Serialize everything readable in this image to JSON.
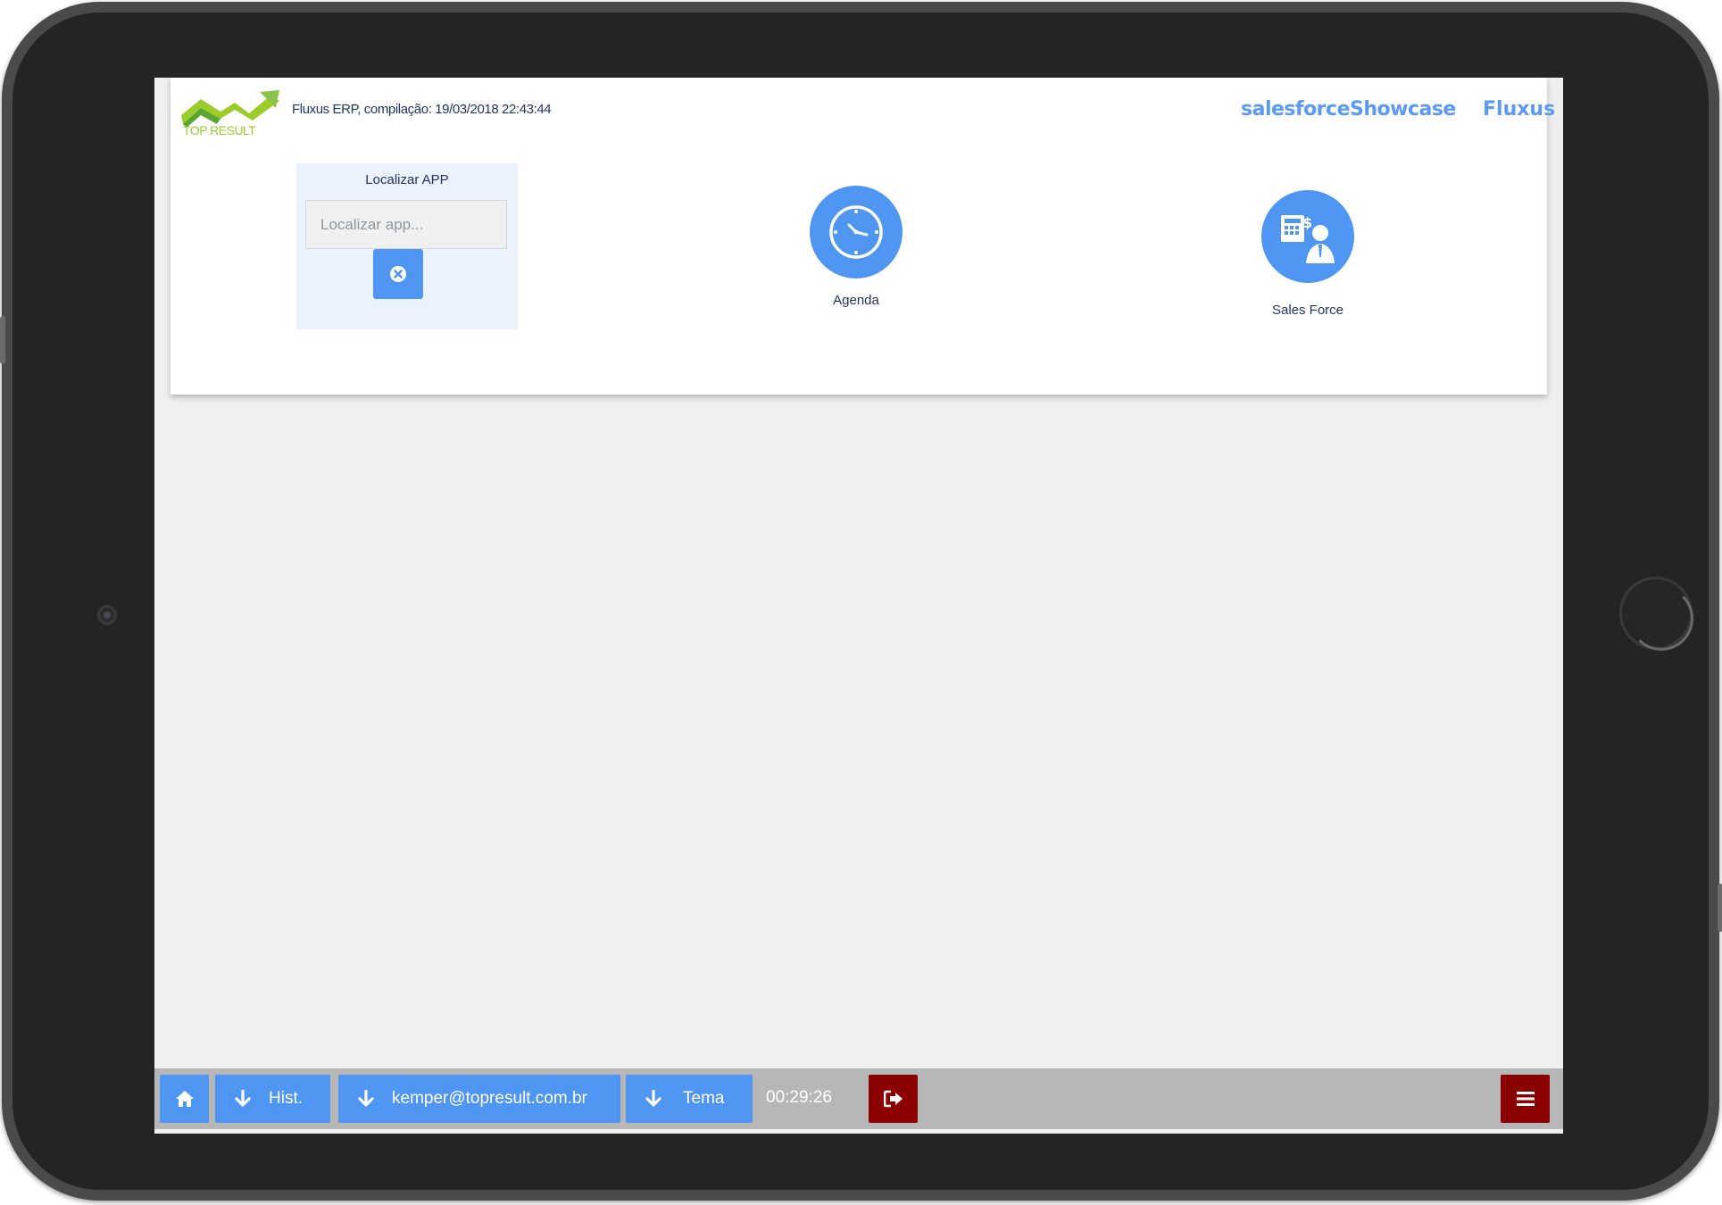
{
  "header": {
    "logo_text": "TOP RESULT",
    "build_info": "Fluxus ERP, compilação: 19/03/2018 22:43:44",
    "org_name": "salesforceShowcase",
    "app_name": "Fluxus"
  },
  "search": {
    "title": "Localizar APP",
    "placeholder": "Localizar app...",
    "clear_icon": "times-circle-icon"
  },
  "apps": [
    {
      "label": "Agenda",
      "icon": "clock-icon"
    },
    {
      "label": "Sales Force",
      "icon": "salesperson-icon"
    }
  ],
  "footer": {
    "home_icon": "home-icon",
    "history_label": "Hist.",
    "user_label": "kemper@topresult.com.br",
    "theme_label": "Tema",
    "session_timer": "00:29:26",
    "logout_icon": "sign-out-icon",
    "menu_icon": "hamburger-menu-icon"
  },
  "colors": {
    "accent": "#4f95f2",
    "danger": "#8b0000",
    "text_dark": "#22335e",
    "brand_text": "#5a9af5",
    "footer_bg": "#b7b7b7",
    "screen_bg": "#efefef"
  }
}
